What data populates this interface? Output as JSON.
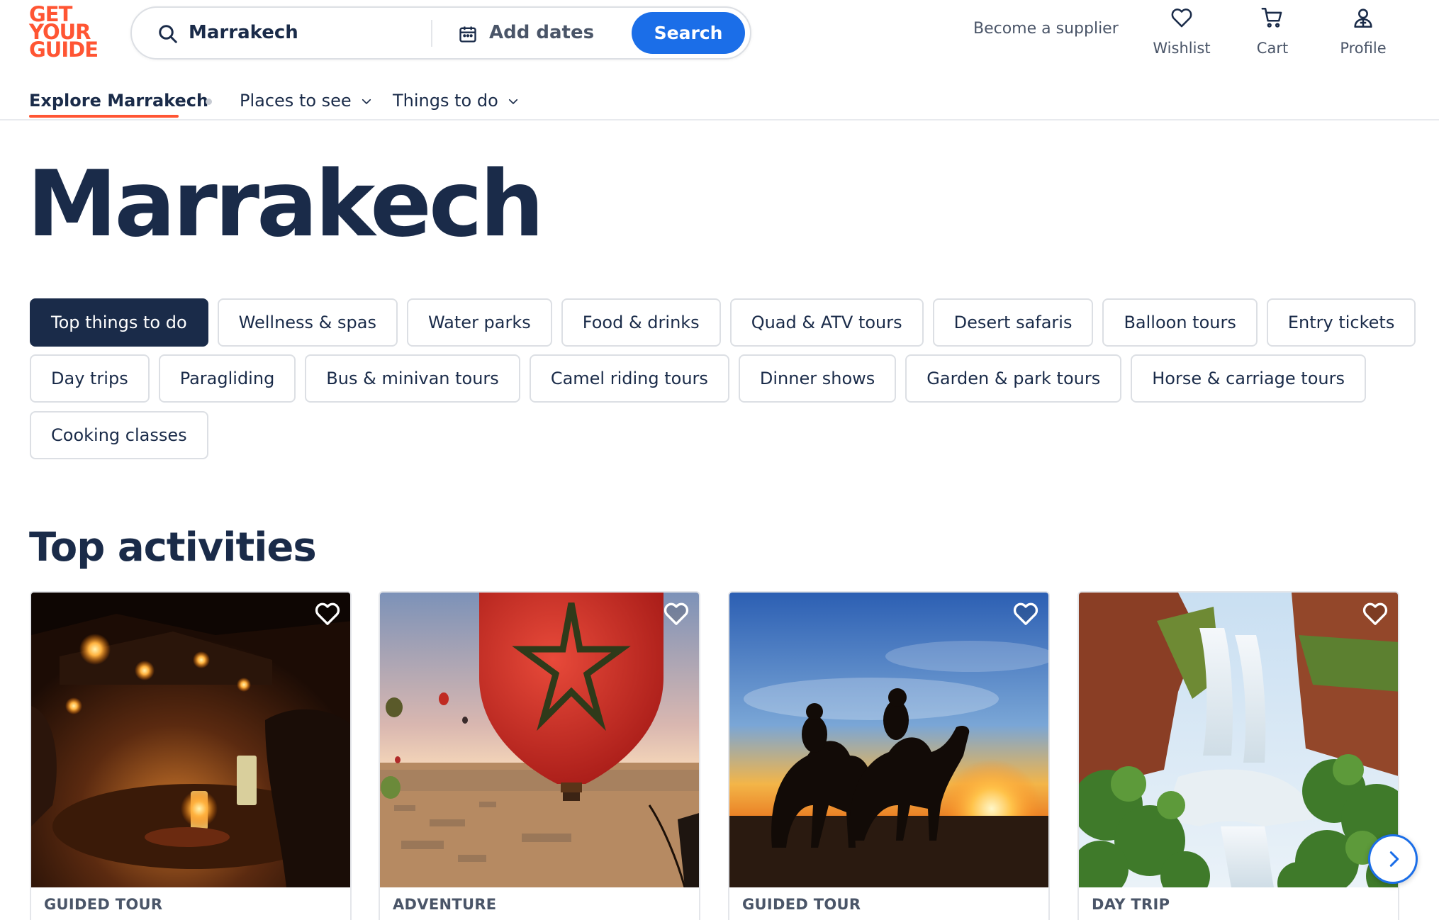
{
  "header": {
    "logo": [
      "GET",
      "YOUR",
      "GUIDE"
    ],
    "search": {
      "location_value": "Marrakech",
      "dates_placeholder": "Add dates",
      "button_label": "Search"
    },
    "supplier_link": "Become a supplier",
    "actions": {
      "wishlist": "Wishlist",
      "cart": "Cart",
      "profile": "Profile"
    }
  },
  "subnav": {
    "explore": "Explore Marrakech",
    "places": "Places to see",
    "things": "Things to do"
  },
  "page_title": "Marrakech",
  "chips": {
    "row1": [
      "Top things to do",
      "Wellness & spas",
      "Water parks",
      "Food & drinks",
      "Quad & ATV tours",
      "Desert safaris",
      "Balloon tours",
      "Entry tickets"
    ],
    "row2": [
      "Day trips",
      "Paragliding",
      "Bus & minivan tours",
      "Camel riding tours",
      "Dinner shows",
      "Garden & park tours",
      "Horse & carriage tours"
    ],
    "row3": [
      "Cooking classes"
    ]
  },
  "section_title": "Top activities",
  "cards": [
    {
      "category": "GUIDED TOUR",
      "image": "desert-camp-dinner-photo"
    },
    {
      "category": "ADVENTURE",
      "image": "hot-air-balloon-photo"
    },
    {
      "category": "GUIDED TOUR",
      "image": "camel-ride-sunset-photo"
    },
    {
      "category": "DAY TRIP",
      "image": "waterfall-photo"
    }
  ],
  "colors": {
    "brand": "#ff5533",
    "primary": "#1b6ee8",
    "text": "#1a2b49"
  }
}
